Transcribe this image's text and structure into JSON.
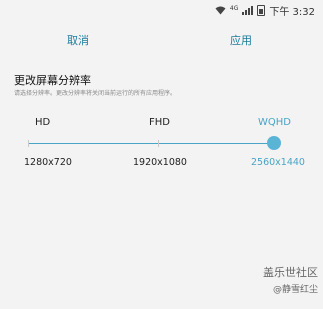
{
  "status_bar": {
    "network_type": "4G",
    "time": "下午 3:32"
  },
  "action_bar": {
    "cancel_label": "取消",
    "apply_label": "应用"
  },
  "section": {
    "title": "更改屏幕分辨率",
    "description": "请选择分辨率。更改分辨率将关闭当前运行的所有应用程序。"
  },
  "resolution_slider": {
    "options": [
      {
        "label": "HD",
        "value": "1280x720"
      },
      {
        "label": "FHD",
        "value": "1920x1080"
      },
      {
        "label": "WQHD",
        "value": "2560x1440"
      }
    ],
    "selected_index": 2,
    "accent_color": "#4aa4c6"
  },
  "watermark": {
    "title": "盖乐世社区",
    "author": "@静雪红尘"
  }
}
